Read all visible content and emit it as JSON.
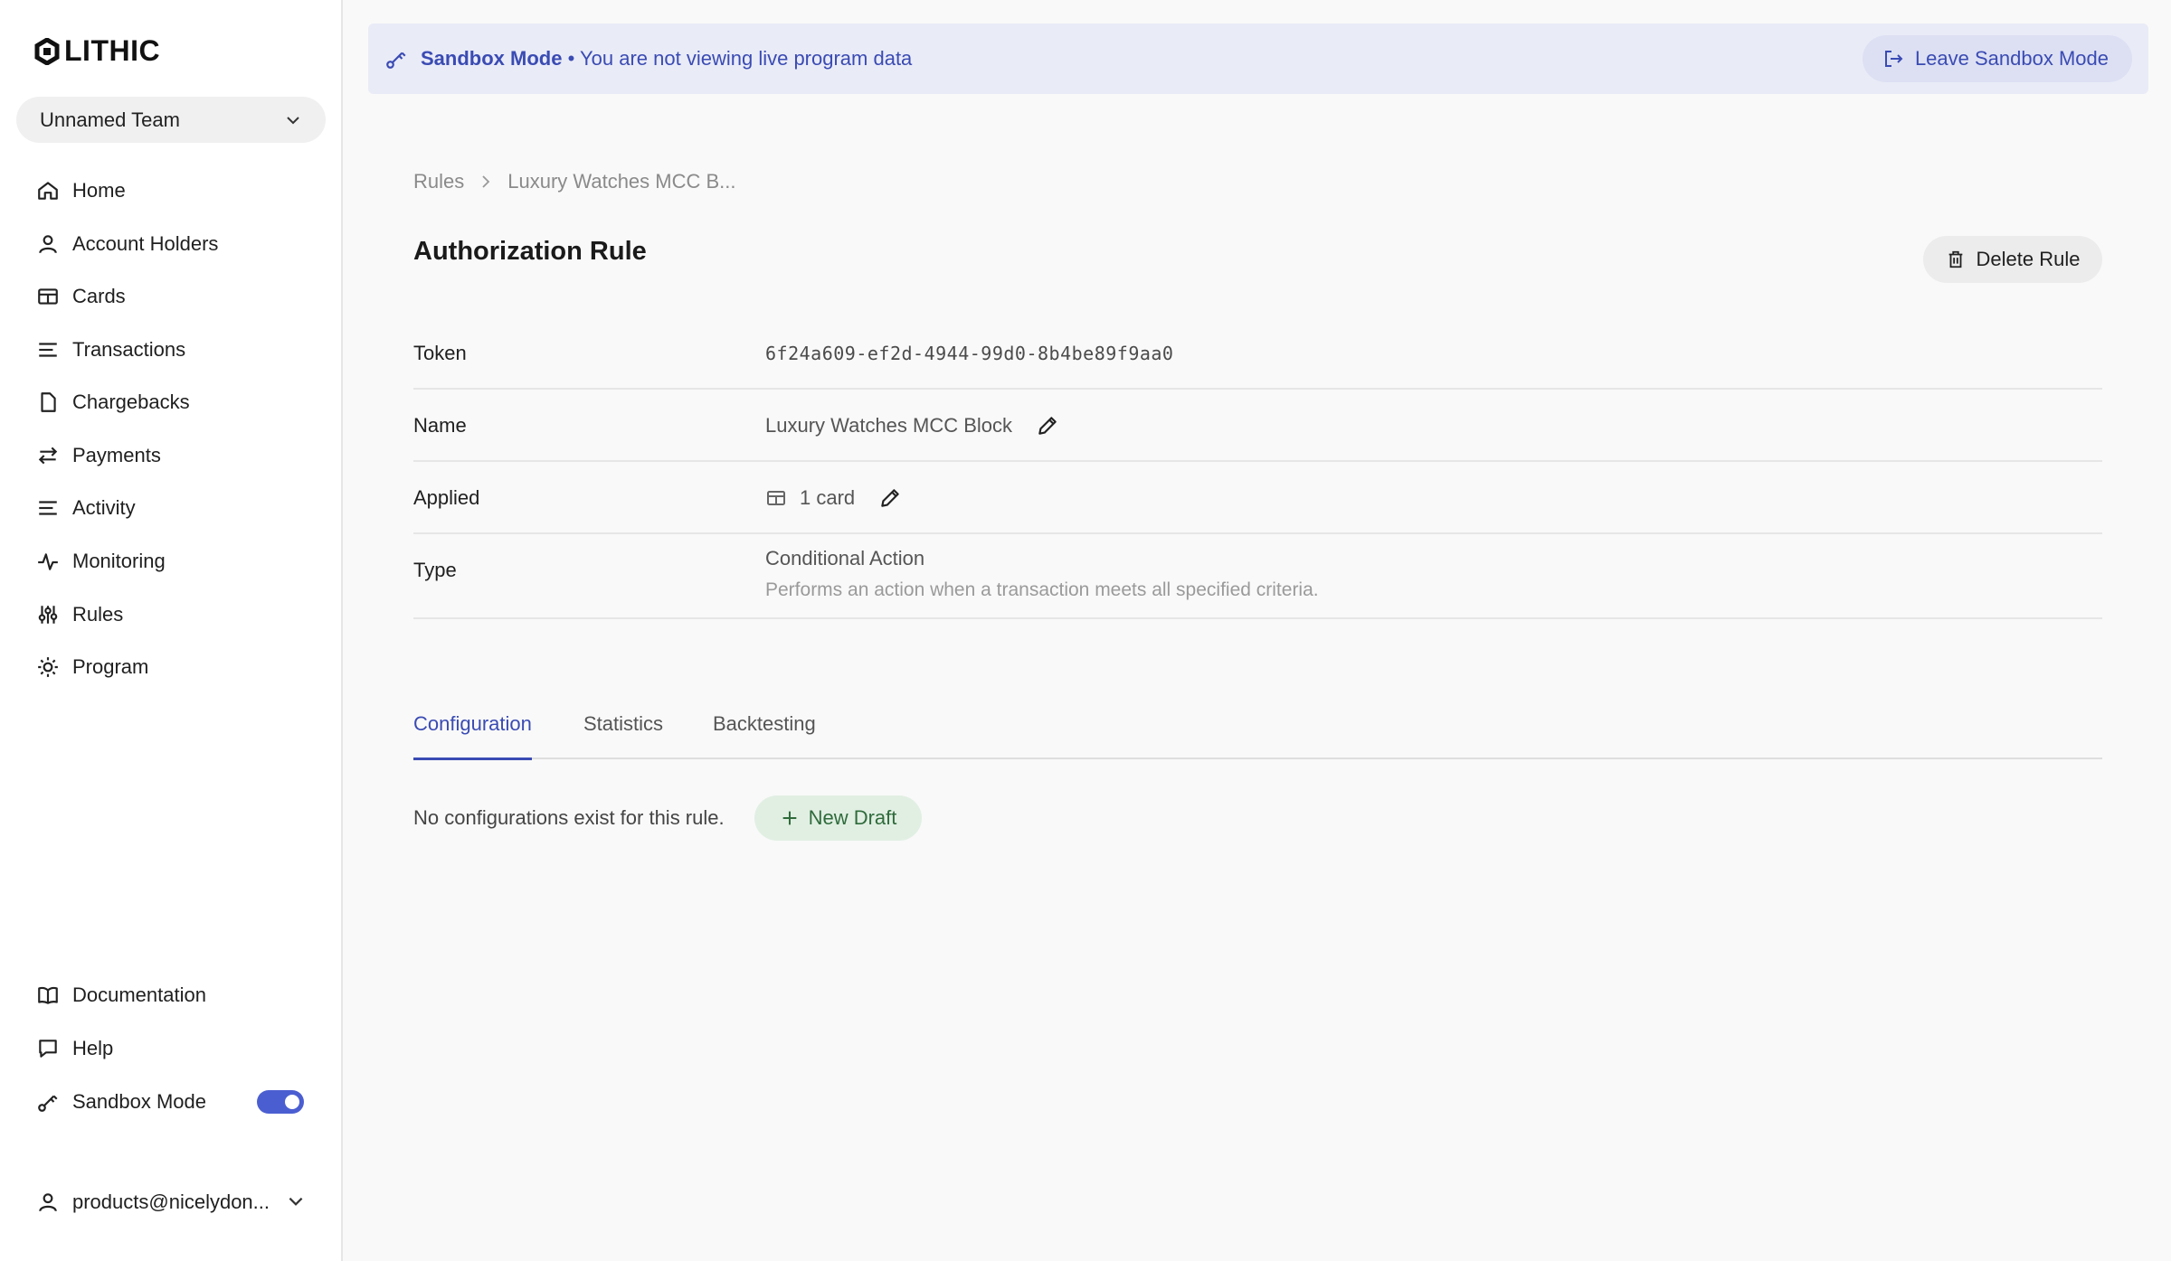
{
  "brand": {
    "name": "LITHIC"
  },
  "sidebar": {
    "team": "Unnamed Team",
    "items": [
      {
        "label": "Home",
        "icon": "home-icon"
      },
      {
        "label": "Account Holders",
        "icon": "user-icon"
      },
      {
        "label": "Cards",
        "icon": "card-icon"
      },
      {
        "label": "Transactions",
        "icon": "list-icon"
      },
      {
        "label": "Chargebacks",
        "icon": "document-icon"
      },
      {
        "label": "Payments",
        "icon": "arrows-icon"
      },
      {
        "label": "Activity",
        "icon": "list-icon"
      },
      {
        "label": "Monitoring",
        "icon": "pulse-icon"
      },
      {
        "label": "Rules",
        "icon": "sliders-icon"
      },
      {
        "label": "Program",
        "icon": "gear-icon"
      }
    ],
    "bottom_items": [
      {
        "label": "Documentation",
        "icon": "book-icon"
      },
      {
        "label": "Help",
        "icon": "chat-icon"
      },
      {
        "label": "Sandbox Mode",
        "icon": "key-icon"
      }
    ],
    "sandbox_toggle_on": true,
    "user": "products@nicelydon..."
  },
  "banner": {
    "title": "Sandbox Mode",
    "message": "• You are not viewing live program data",
    "leave_label": "Leave Sandbox Mode"
  },
  "breadcrumb": {
    "root": "Rules",
    "current": "Luxury Watches MCC B..."
  },
  "page": {
    "title": "Authorization Rule",
    "delete_label": "Delete Rule"
  },
  "details": {
    "token_label": "Token",
    "token_value": "6f24a609-ef2d-4944-99d0-8b4be89f9aa0",
    "name_label": "Name",
    "name_value": "Luxury Watches MCC Block",
    "applied_label": "Applied",
    "applied_value": "1 card",
    "type_label": "Type",
    "type_value": "Conditional Action",
    "type_description": "Performs an action when a transaction meets all specified criteria."
  },
  "tabs": [
    "Configuration",
    "Statistics",
    "Backtesting"
  ],
  "configuration": {
    "empty_text": "No configurations exist for this rule.",
    "new_draft_label": "New Draft"
  },
  "colors": {
    "accent": "#3a4bb3",
    "toggle": "#4b5ed1",
    "success_bg": "#e1efe3",
    "success_text": "#2f6b3b"
  }
}
